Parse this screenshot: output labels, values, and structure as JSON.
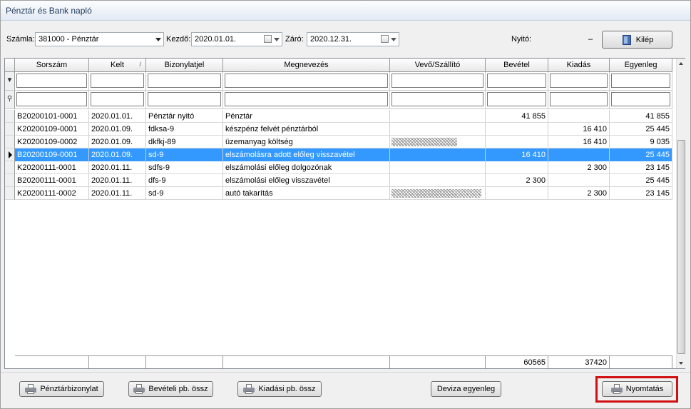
{
  "window": {
    "title": "Pénztár és Bank napló"
  },
  "toolbar": {
    "account_label": "Számla:",
    "account_value": "381000 - Pénztár",
    "start_label": "Kezdő:",
    "start_value": "2020.01.01.",
    "end_label": "Záró:",
    "end_value": "2020.12.31.",
    "opening_label": "Nyitó:",
    "opening_value": "–",
    "exit_label": "Kilép"
  },
  "grid": {
    "columns": [
      "Sorszám",
      "Kelt",
      "Bizonylatjel",
      "Megnevezés",
      "Vevő/Szállító",
      "Bevétel",
      "Kiadás",
      "Egyenleg"
    ],
    "rows": [
      {
        "sorszam": "B20200101-0001",
        "kelt": "2020.01.01.",
        "bizonylat": "Pénztár nyitó",
        "megnevezes": "Pénztár",
        "partner": "",
        "bevetel": "41 855",
        "kiadas": "",
        "egyenleg": "41 855"
      },
      {
        "sorszam": "K20200109-0001",
        "kelt": "2020.01.09.",
        "bizonylat": "fdksa-9",
        "megnevezes": "készpénz felvét pénztárból",
        "partner": "",
        "bevetel": "",
        "kiadas": "16 410",
        "egyenleg": "25 445"
      },
      {
        "sorszam": "K20200109-0002",
        "kelt": "2020.01.09.",
        "bizonylat": "dkfkj-89",
        "megnevezes": "üzemanyag költség",
        "partner": "",
        "bevetel": "",
        "kiadas": "16 410",
        "egyenleg": "9 035"
      },
      {
        "sorszam": "B20200109-0001",
        "kelt": "2020.01.09.",
        "bizonylat": "sd-9",
        "megnevezes": "elszámolásra adott előleg visszavétel",
        "partner": "",
        "bevetel": "16 410",
        "kiadas": "",
        "egyenleg": "25 445"
      },
      {
        "sorszam": "K20200111-0001",
        "kelt": "2020.01.11.",
        "bizonylat": "sdfs-9",
        "megnevezes": "elszámolási előleg dolgozónak",
        "partner": "",
        "bevetel": "",
        "kiadas": "2 300",
        "egyenleg": "23 145"
      },
      {
        "sorszam": "B20200111-0001",
        "kelt": "2020.01.11.",
        "bizonylat": "dfs-9",
        "megnevezes": "elszámolási előleg visszavétel",
        "partner": "",
        "bevetel": "2 300",
        "kiadas": "",
        "egyenleg": "25 445"
      },
      {
        "sorszam": "K20200111-0002",
        "kelt": "2020.01.11.",
        "bizonylat": "sd-9",
        "megnevezes": "autó takarítás",
        "partner": "",
        "bevetel": "",
        "kiadas": "2 300",
        "egyenleg": "23 145"
      }
    ],
    "selected_row": 3,
    "totals": {
      "bevetel": "60565",
      "kiadas": "37420"
    }
  },
  "buttons": {
    "penztarbizonylat": "Pénztárbizonylat",
    "beveteli": "Bevételi pb. össz",
    "kiadasi": "Kiadási pb. össz",
    "deviza": "Deviza egyenleg",
    "nyomtatas": "Nyomtatás"
  },
  "colors": {
    "selection": "#3399ff",
    "highlight_box": "#d01010"
  }
}
